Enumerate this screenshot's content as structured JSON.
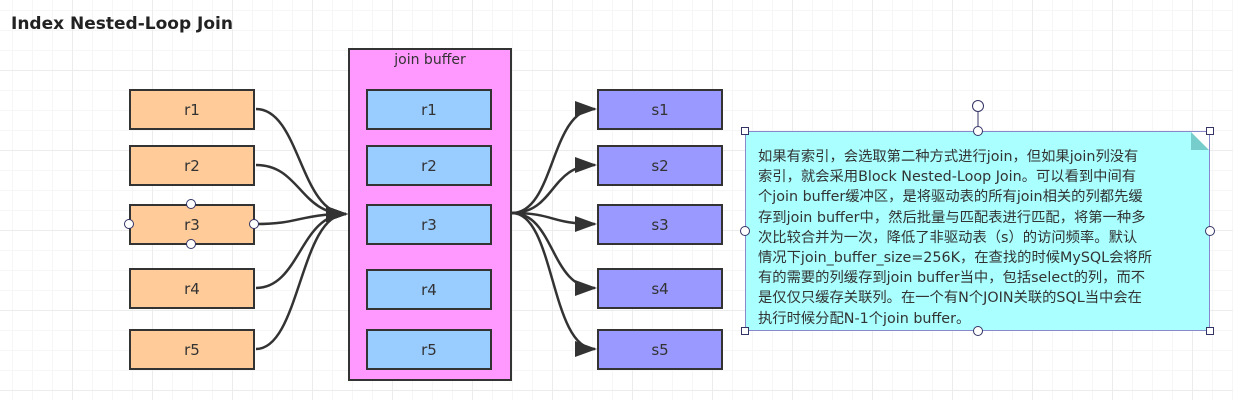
{
  "title": "Index Nested-Loop Join",
  "left_rows": [
    "r1",
    "r2",
    "r3",
    "r4",
    "r5"
  ],
  "buffer": {
    "label": "join buffer",
    "rows": [
      "r1",
      "r2",
      "r3",
      "r4",
      "r5"
    ]
  },
  "right_rows": [
    "s1",
    "s2",
    "s3",
    "s4",
    "s5"
  ],
  "note": {
    "lines": [
      "如果有索引，会选取第二种方式进行join，但如果join列没有",
      "索引，就会采用Block Nested-Loop Join。可以看到中间有",
      "个join buffer缓冲区，是将驱动表的所有join相关的列都先缓",
      "存到join buffer中，然后批量与匹配表进行匹配，将第一种多",
      "次比较合并为一次，降低了非驱动表（s）的访问频率。默认",
      "情况下join_buffer_size=256K，在查找的时候MySQL会将所",
      "有的需要的列缓存到join buffer当中，包括select的列，而不",
      "是仅仅只缓存关联列。在一个有N个JOIN关联的SQL当中会在",
      "执行时候分配N-1个join buffer。"
    ]
  },
  "colors": {
    "left": "#ffcc99",
    "buffer": "#ff99ff",
    "buffer_rows": "#99ccff",
    "right": "#9999ff",
    "note": "#aaffff"
  }
}
